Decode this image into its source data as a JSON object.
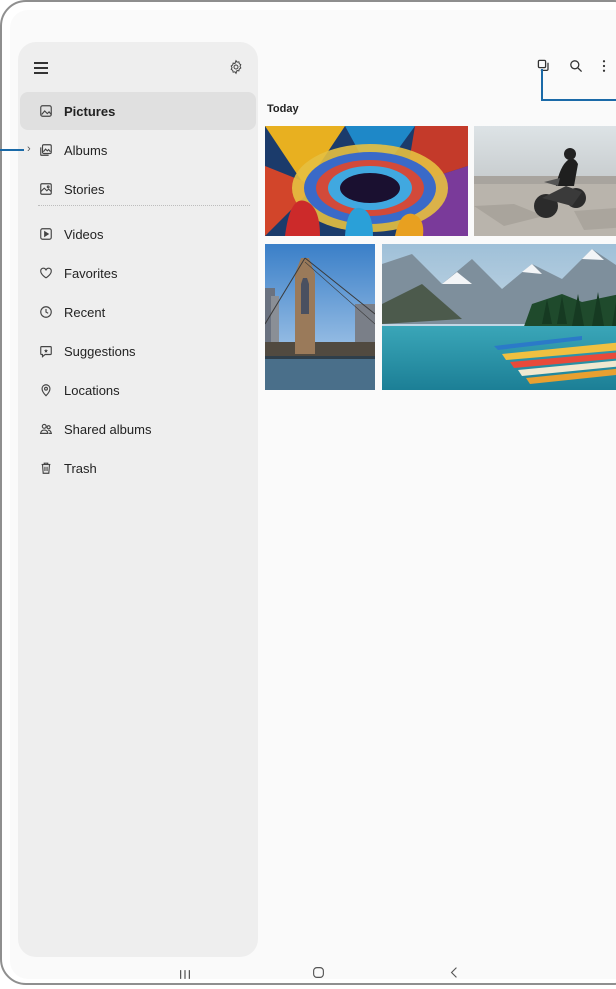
{
  "sidebar": {
    "items": [
      {
        "label": "Pictures",
        "icon": "picture-icon"
      },
      {
        "label": "Albums",
        "icon": "albums-icon"
      },
      {
        "label": "Stories",
        "icon": "stories-icon"
      },
      {
        "label": "Videos",
        "icon": "video-icon"
      },
      {
        "label": "Favorites",
        "icon": "heart-icon"
      },
      {
        "label": "Recent",
        "icon": "clock-icon"
      },
      {
        "label": "Suggestions",
        "icon": "suggestions-icon"
      },
      {
        "label": "Locations",
        "icon": "location-pin-icon"
      },
      {
        "label": "Shared albums",
        "icon": "people-icon"
      },
      {
        "label": "Trash",
        "icon": "trash-icon"
      }
    ],
    "active": "Pictures"
  },
  "main": {
    "section_label": "Today"
  },
  "colors": {
    "callout": "#1a6aa8",
    "sidebar_bg": "#eeeeee",
    "active_bg": "#e0e0e0"
  }
}
